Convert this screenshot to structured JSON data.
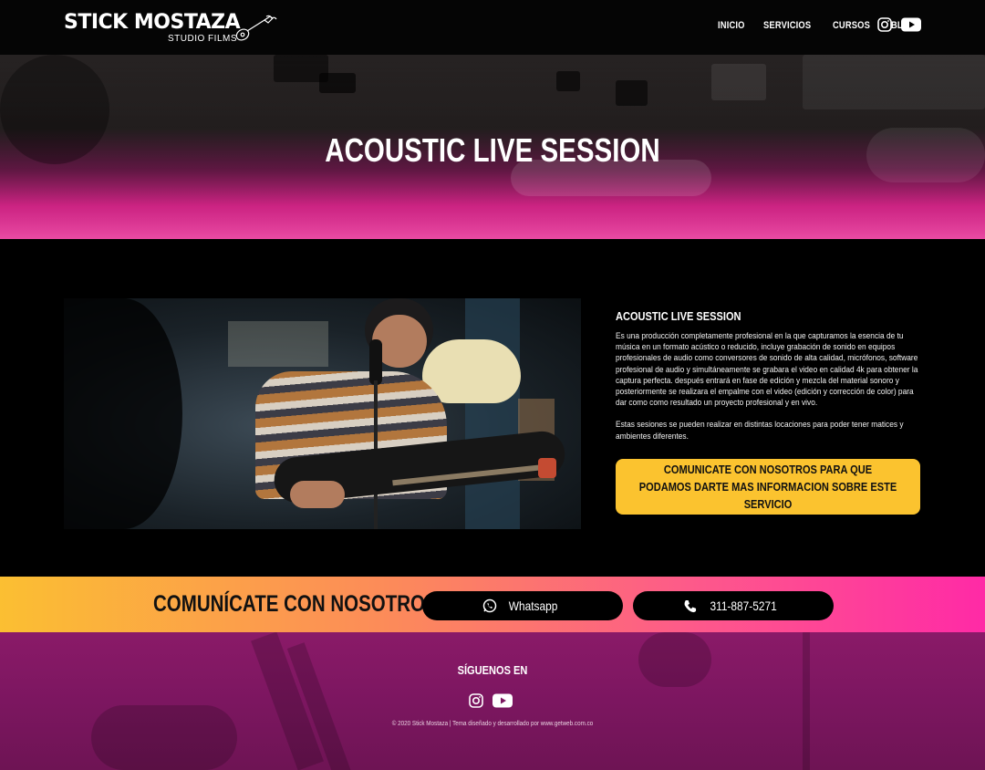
{
  "header": {
    "logo_main": "STICK MOSTAZA",
    "logo_sub": "STUDIO FILMS",
    "nav": [
      "INICIO",
      "SERVICIOS",
      "CURSOS",
      "BLOG"
    ]
  },
  "hero": {
    "title": "ACOUSTIC LIVE SESSION"
  },
  "service": {
    "title": "ACOUSTIC LIVE SESSION",
    "paragraph1": "Es una producción completamente profesional en la que capturamos la esencia de tu música en un formato acústico o reducido, incluye grabación de sonido en equipos profesionales de audio como conversores de sonido de alta calidad, micrófonos, software profesional de audio y simultáneamente se grabara el video en calidad 4k para obtener la captura perfecta. después entrará en fase de edición y mezcla del material sonoro y posteriormente se realizara el empalme con el video (edición y corrección de color) para dar como como resultado un proyecto profesional y en vivo.",
    "paragraph2": "Estas sesiones se pueden realizar en distintas locaciones para poder tener matices y ambientes diferentes.",
    "cta": "COMUNICATE CON NOSOTROS PARA QUE PODAMOS DARTE MAS INFORMACION SOBRE ESTE SERVICIO"
  },
  "contact": {
    "title": "COMUNÍCATE CON NOSOTROS",
    "whatsapp": "Whatsapp",
    "phone": "311-887-5271"
  },
  "footer": {
    "follow": "SÍGUENOS EN",
    "copyright": "© 2020 Stick Mostaza | Tema diseñado y desarrollado por www.getweb.com.co"
  },
  "colors": {
    "accent_yellow": "#fbc32f",
    "accent_pink": "#ff2aa6",
    "footer_purple": "#7c1660"
  },
  "icons": [
    "instagram-icon",
    "youtube-icon",
    "whatsapp-icon",
    "phone-icon",
    "guitar-icon"
  ]
}
